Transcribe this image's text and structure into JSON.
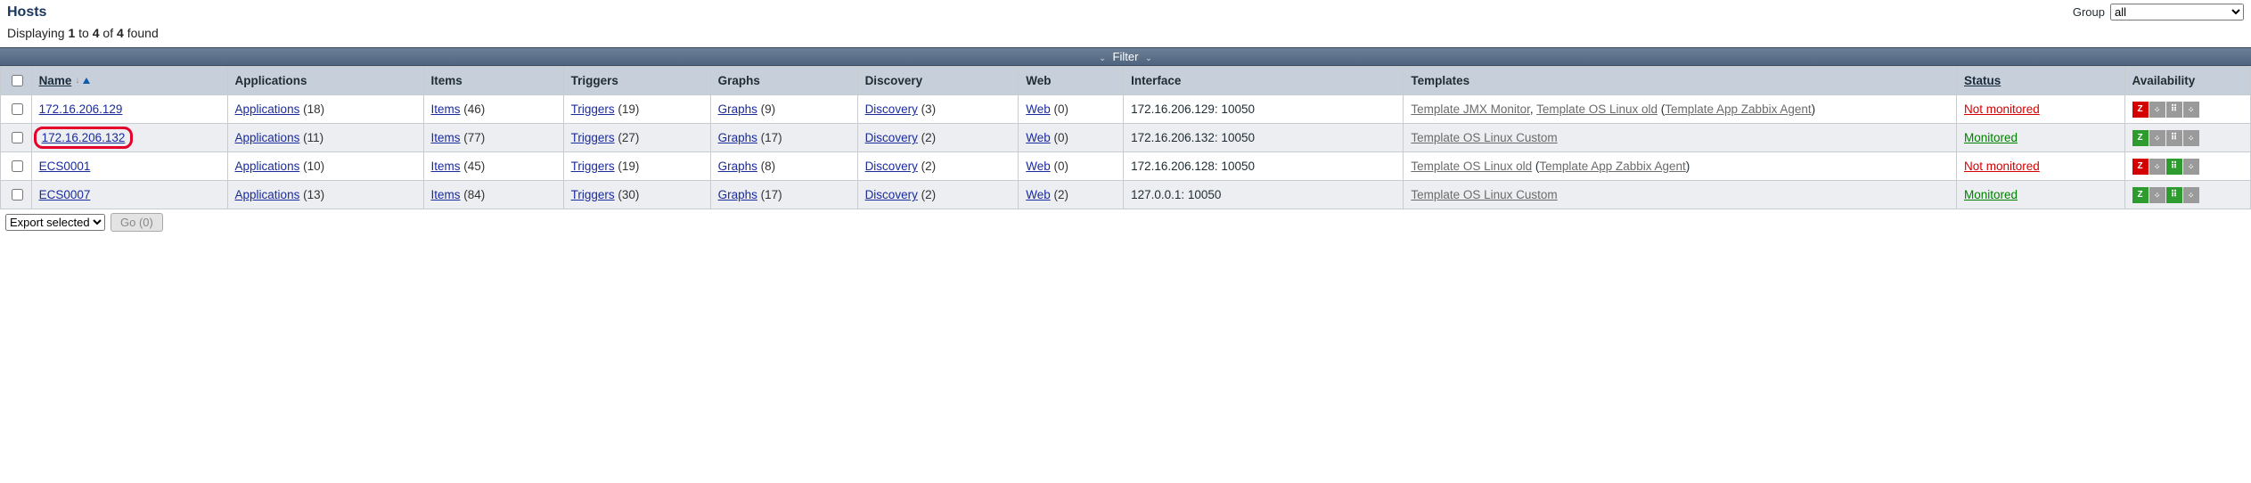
{
  "header": {
    "title": "Hosts",
    "group_label": "Group",
    "group_selected": "all",
    "group_options": [
      "all"
    ]
  },
  "displaying": {
    "prefix": "Displaying ",
    "from": "1",
    "mid1": " to ",
    "to": "4",
    "mid2": " of ",
    "total": "4",
    "suffix": " found"
  },
  "filter": {
    "label": "Filter"
  },
  "columns": {
    "name": "Name",
    "applications": "Applications",
    "items": "Items",
    "triggers": "Triggers",
    "graphs": "Graphs",
    "discovery": "Discovery",
    "web": "Web",
    "interface": "Interface",
    "templates": "Templates",
    "status": "Status",
    "availability": "Availability"
  },
  "link_labels": {
    "applications": "Applications",
    "items": "Items",
    "triggers": "Triggers",
    "graphs": "Graphs",
    "discovery": "Discovery",
    "web": "Web"
  },
  "status_labels": {
    "not_monitored": "Not monitored",
    "monitored": "Monitored"
  },
  "rows": [
    {
      "name": "172.16.206.129",
      "highlight": false,
      "apps": "18",
      "items": "46",
      "triggers": "19",
      "graphs": "9",
      "discovery": "3",
      "web": "0",
      "interface": "172.16.206.129: 10050",
      "templates": [
        {
          "text": "Template JMX Monitor"
        },
        {
          "sep": ", "
        },
        {
          "text": "Template OS Linux old"
        },
        {
          "sep": " ("
        },
        {
          "text": "Template App Zabbix Agent"
        },
        {
          "sep": ")"
        }
      ],
      "status": "not_monitored",
      "avail": [
        "red",
        "gray",
        "gray",
        "gray"
      ]
    },
    {
      "name": "172.16.206.132",
      "highlight": true,
      "apps": "11",
      "items": "77",
      "triggers": "27",
      "graphs": "17",
      "discovery": "2",
      "web": "0",
      "interface": "172.16.206.132: 10050",
      "templates": [
        {
          "text": "Template OS Linux Custom"
        }
      ],
      "status": "monitored",
      "avail": [
        "green",
        "gray",
        "gray",
        "gray"
      ]
    },
    {
      "name": "ECS0001",
      "highlight": false,
      "apps": "10",
      "items": "45",
      "triggers": "19",
      "graphs": "8",
      "discovery": "2",
      "web": "0",
      "interface": "172.16.206.128: 10050",
      "templates": [
        {
          "text": "Template OS Linux old"
        },
        {
          "sep": " ("
        },
        {
          "text": "Template App Zabbix Agent"
        },
        {
          "sep": ")"
        }
      ],
      "status": "not_monitored",
      "avail": [
        "red",
        "gray",
        "green",
        "gray"
      ]
    },
    {
      "name": "ECS0007",
      "highlight": false,
      "apps": "13",
      "items": "84",
      "triggers": "30",
      "graphs": "17",
      "discovery": "2",
      "web": "2",
      "interface": "127.0.0.1: 10050",
      "templates": [
        {
          "text": "Template OS Linux Custom"
        }
      ],
      "status": "monitored",
      "avail": [
        "green",
        "gray",
        "green",
        "gray"
      ]
    }
  ],
  "footer": {
    "bulk_action": "Export selected",
    "go_label": "Go (0)"
  },
  "avail_glyphs": [
    "Z",
    "܀",
    "⠿",
    "܀"
  ]
}
